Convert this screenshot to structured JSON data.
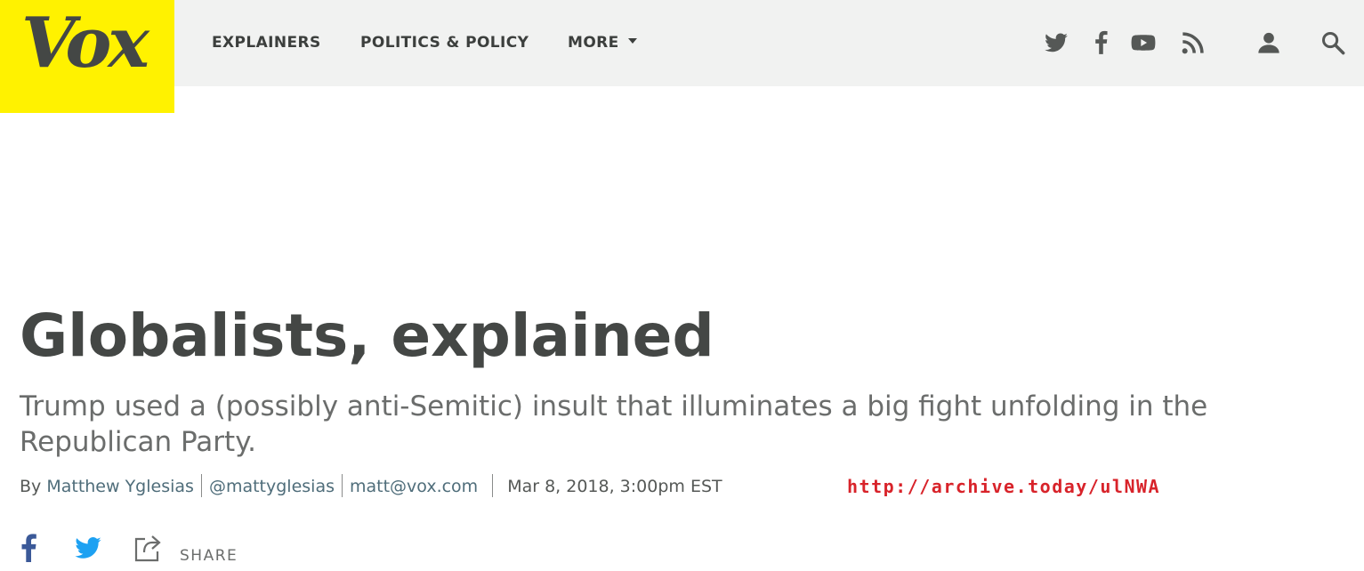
{
  "logo": {
    "text": "Vox",
    "color": "#fff200"
  },
  "nav": {
    "items": [
      {
        "label": "EXPLAINERS"
      },
      {
        "label": "POLITICS & POLICY"
      },
      {
        "label": "MORE"
      }
    ]
  },
  "header_icons": [
    "twitter-icon",
    "facebook-icon",
    "youtube-icon",
    "rss-icon",
    "user-icon",
    "search-icon"
  ],
  "article": {
    "title": "Globalists, explained",
    "dek": "Trump used a (possibly anti-Semitic) insult that illuminates a big fight unfolding in the Republican Party.",
    "byline": {
      "prefix": "By",
      "author": "Matthew Yglesias",
      "handle": "@mattyglesias",
      "email": "matt@vox.com",
      "date": "Mar 8, 2018, 3:00pm EST"
    },
    "archive_url": "http://archive.today/ulNWA",
    "share_label": "SHARE"
  },
  "colors": {
    "brand_yellow": "#fff200",
    "header_bg": "#f1f2f1",
    "text_dark": "#444745",
    "link": "#4f6d7a",
    "archive_red": "#d8232a",
    "twitter_blue": "#1da1f2",
    "facebook_blue": "#3b5998"
  }
}
